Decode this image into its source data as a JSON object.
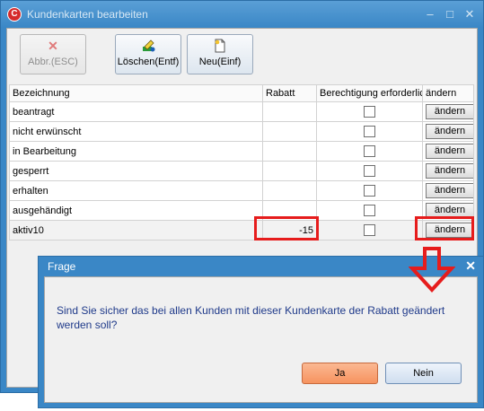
{
  "window": {
    "title": "Kundenkarten bearbeiten",
    "app_icon_char": "C",
    "controls": {
      "minimize": "–",
      "maximize": "□",
      "close": "✕"
    }
  },
  "toolbar": {
    "cancel": {
      "label": "Abbr.(ESC)",
      "icon": "x-icon"
    },
    "delete": {
      "label": "Löschen(Entf)",
      "icon": "delete-icon"
    },
    "new": {
      "label": "Neu(Einf)",
      "icon": "new-doc-icon"
    }
  },
  "grid": {
    "headers": {
      "bezeichnung": "Bezeichnung",
      "rabatt": "Rabatt",
      "berechtigung": "Berechtigung erforderlich",
      "aendern": "ändern"
    },
    "rows": [
      {
        "bezeichnung": "beantragt",
        "rabatt": "",
        "checked": false,
        "button": "ändern"
      },
      {
        "bezeichnung": "nicht erwünscht",
        "rabatt": "",
        "checked": false,
        "button": "ändern"
      },
      {
        "bezeichnung": "in Bearbeitung",
        "rabatt": "",
        "checked": false,
        "button": "ändern"
      },
      {
        "bezeichnung": "gesperrt",
        "rabatt": "",
        "checked": false,
        "button": "ändern"
      },
      {
        "bezeichnung": "erhalten",
        "rabatt": "",
        "checked": false,
        "button": "ändern"
      },
      {
        "bezeichnung": "ausgehändigt",
        "rabatt": "",
        "checked": false,
        "button": "ändern"
      },
      {
        "bezeichnung": "aktiv10",
        "rabatt": "-15",
        "checked": false,
        "button": "ändern"
      }
    ]
  },
  "dialog": {
    "title": "Frage",
    "close": "✕",
    "message": "Sind Sie sicher das bei allen Kunden mit dieser Kundenkarte der Rabatt geändert werden soll?",
    "yes_label": "Ja",
    "no_label": "Nein"
  },
  "colors": {
    "title_bar": "#3a87c6",
    "highlight": "#e61c1c",
    "yes_button": "#f6935f",
    "message_text": "#1f3a8a"
  }
}
